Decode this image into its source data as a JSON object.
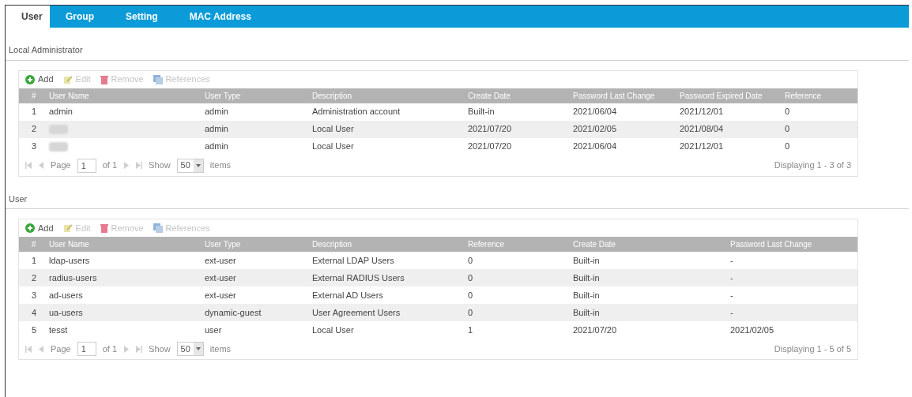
{
  "tabs": [
    {
      "label": "User",
      "selected": true
    },
    {
      "label": "Group",
      "selected": false
    },
    {
      "label": "Setting",
      "selected": false
    },
    {
      "label": "MAC Address",
      "selected": false
    }
  ],
  "sections": [
    {
      "title": "Local Administrator",
      "toolbar": [
        {
          "kind": "add",
          "label": "Add",
          "disabled": false
        },
        {
          "kind": "edit",
          "label": "Edit",
          "disabled": true
        },
        {
          "kind": "remove",
          "label": "Remove",
          "disabled": true
        },
        {
          "kind": "references",
          "label": "References",
          "disabled": true
        }
      ],
      "columns": [
        "#",
        "User Name",
        "User Type",
        "Description",
        "Create Date",
        "Password Last Change",
        "Password Expired Date",
        "Reference"
      ],
      "rows": [
        {
          "cells": [
            "1",
            "admin",
            "admin",
            "Administration account",
            "Built-in",
            "2021/06/04",
            "2021/12/01",
            "0"
          ]
        },
        {
          "cells": [
            "2",
            null,
            "admin",
            "Local User",
            "2021/07/20",
            "2021/02/05",
            "2021/08/04",
            "0"
          ]
        },
        {
          "cells": [
            "3",
            null,
            "admin",
            "Local User",
            "2021/07/20",
            "2021/06/04",
            "2021/12/01",
            "0"
          ]
        }
      ],
      "pager": {
        "page_label": "Page",
        "page": "1",
        "of": "of 1",
        "show_label": "Show",
        "show": "50",
        "items_label": "items",
        "summary": "Displaying 1 - 3 of 3"
      }
    },
    {
      "title": "User",
      "toolbar": [
        {
          "kind": "add",
          "label": "Add",
          "disabled": false
        },
        {
          "kind": "edit",
          "label": "Edit",
          "disabled": true
        },
        {
          "kind": "remove",
          "label": "Remove",
          "disabled": true
        },
        {
          "kind": "references",
          "label": "References",
          "disabled": true
        }
      ],
      "columns": [
        "#",
        "User Name",
        "User Type",
        "Description",
        "Reference",
        "Create Date",
        "Password Last Change"
      ],
      "rows": [
        {
          "cells": [
            "1",
            "ldap-users",
            "ext-user",
            "External LDAP Users",
            "0",
            "Built-in",
            "-"
          ]
        },
        {
          "cells": [
            "2",
            "radius-users",
            "ext-user",
            "External RADIUS Users",
            "0",
            "Built-in",
            "-"
          ]
        },
        {
          "cells": [
            "3",
            "ad-users",
            "ext-user",
            "External AD Users",
            "0",
            "Built-in",
            "-"
          ]
        },
        {
          "cells": [
            "4",
            "ua-users",
            "dynamic-guest",
            "User Agreement Users",
            "0",
            "Built-in",
            "-"
          ]
        },
        {
          "cells": [
            "5",
            "tesst",
            "user",
            "Local User",
            "1",
            "2021/07/20",
            "2021/02/05"
          ]
        }
      ],
      "pager": {
        "page_label": "Page",
        "page": "1",
        "of": "of 1",
        "show_label": "Show",
        "show": "50",
        "items_label": "items",
        "summary": "Displaying 1 - 5 of 5"
      }
    }
  ]
}
